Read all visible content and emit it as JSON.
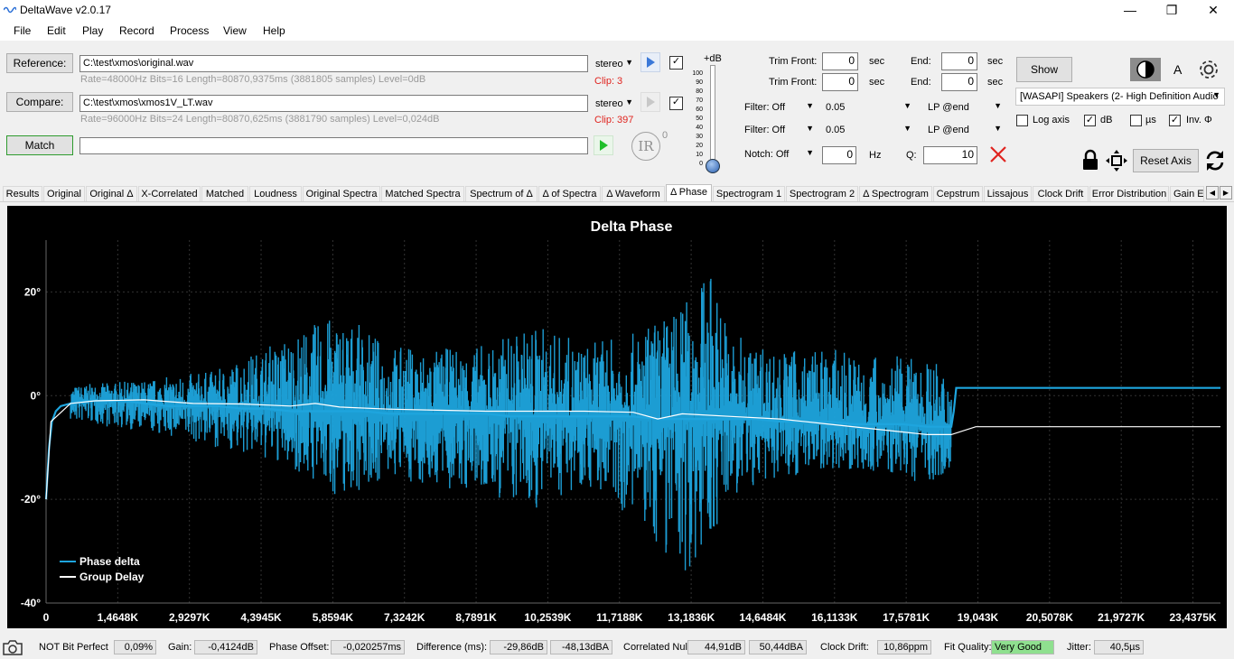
{
  "window": {
    "title": "DeltaWave v2.0.17",
    "minimize": "—",
    "restore": "❐",
    "close": "✕"
  },
  "menu": [
    "File",
    "Edit",
    "Play",
    "Record",
    "Process",
    "View",
    "Help"
  ],
  "reference": {
    "button": "Reference:",
    "path": "C:\\test\\xmos\\original.wav",
    "info": "Rate=48000Hz Bits=16 Length=80870,9375ms (3881805 samples) Level=0dB",
    "channel": "stereo",
    "clip": "Clip: 3"
  },
  "compare": {
    "button": "Compare:",
    "path": "C:\\test\\xmos\\xmos1V_LT.wav",
    "info": "Rate=96000Hz Bits=24 Length=80870,625ms (3881790 samples) Level=0,024dB",
    "channel": "stereo",
    "clip": "Clip: 397"
  },
  "match": {
    "button": "Match",
    "ir_label": "IR",
    "ir_sup": "0"
  },
  "level_slider": {
    "title": "+dB",
    "ticks": [
      "100",
      "90",
      "80",
      "70",
      "60",
      "50",
      "40",
      "30",
      "20",
      "10",
      "0"
    ],
    "value": 0
  },
  "trim": {
    "front_label": "Trim Front:",
    "front1": "0",
    "front2": "0",
    "end_label": "End:",
    "end1": "0",
    "end2": "0",
    "unit": "sec"
  },
  "filters": {
    "filter1": "Filter: Off",
    "filter1_value": "0.05",
    "filter1_mode": "LP @end",
    "filter2": "Filter: Off",
    "filter2_value": "0.05",
    "filter2_mode": "LP @end",
    "notch": "Notch: Off",
    "notch_value": "0",
    "notch_unit": "Hz",
    "q_label": "Q:",
    "q_value": "10"
  },
  "output": {
    "show_button": "Show",
    "font_label": "A",
    "device": "[WASAPI] Speakers (2- High Definition Audio",
    "log_axis": "Log axis",
    "db": "dB",
    "us": "µs",
    "inv": "Inv. Φ",
    "log_axis_checked": false,
    "db_checked": true,
    "us_checked": false,
    "inv_checked": true,
    "reset_axis": "Reset Axis"
  },
  "tabs": [
    "Results",
    "Original",
    "Original Δ",
    "X-Correlated",
    "Matched",
    "Loudness",
    "Original Spectra",
    "Matched Spectra",
    "Spectrum of Δ",
    "Δ of Spectra",
    "Δ Waveform",
    "Δ Phase",
    "Spectrogram 1",
    "Spectrogram 2",
    "Δ Spectrogram",
    "Cepstrum",
    "Lissajous",
    "Clock Drift",
    "Error Distribution",
    "Gain E"
  ],
  "active_tab": "Δ Phase",
  "chart_data": {
    "type": "line",
    "title": "Delta Phase",
    "xlabel": "",
    "ylabel": "",
    "xlim": [
      0,
      24000
    ],
    "ylim": [
      -40,
      30
    ],
    "x_ticks": [
      "0",
      "1,4648K",
      "2,9297K",
      "4,3945K",
      "5,8594K",
      "7,3242K",
      "8,7891K",
      "10,2539K",
      "11,7188K",
      "13,1836K",
      "14,6484K",
      "16,1133K",
      "17,5781K",
      "19,043K",
      "20,5078K",
      "21,9727K",
      "23,4375K"
    ],
    "y_ticks": [
      "20°",
      "0°",
      "-20°",
      "-40°"
    ],
    "grid": true,
    "legend_placement": "bottom-left",
    "series": [
      {
        "name": "Phase delta",
        "color": "#1ea5de",
        "x": [
          0,
          60,
          120,
          200,
          300,
          500,
          800,
          1200,
          1600,
          2000,
          2500,
          3000,
          3500,
          4000,
          4500,
          5000,
          5500,
          6000,
          6500,
          7000,
          7500,
          8000,
          8500,
          9000,
          9500,
          10000,
          10500,
          11000,
          11500,
          12000,
          12500,
          13000,
          13500,
          14000,
          14500,
          15000,
          15500,
          16000,
          16500,
          17000,
          17500,
          18000,
          18500,
          18550,
          18600,
          19000,
          20000,
          21000,
          22000,
          23000,
          24000
        ],
        "y": [
          -20,
          -10,
          -5,
          -3,
          -2,
          -1.5,
          -1,
          -1,
          -1,
          -1.5,
          -2,
          -2,
          -2,
          -2.5,
          -2.5,
          -3,
          -3,
          -3,
          -3,
          -3.5,
          -3.5,
          -3.5,
          -3.5,
          -3.5,
          -4,
          -4,
          -4,
          -4,
          -4,
          -4,
          -4.5,
          -4.5,
          -4.5,
          -4.5,
          -4.5,
          -5,
          -5,
          -5,
          -5.5,
          -5.5,
          -5.5,
          -6,
          -6,
          -3,
          1.5,
          1.5,
          1.5,
          1.5,
          1.5,
          1.5,
          1.5
        ],
        "envelope": {
          "x": [
            500,
            2000,
            3500,
            5000,
            6000,
            7000,
            8000,
            9000,
            10000,
            11000,
            12000,
            13000,
            13600,
            14000,
            15000,
            16000,
            17000,
            18000,
            18500
          ],
          "upper": [
            2,
            3,
            5,
            12,
            16,
            10,
            9,
            10,
            14,
            10,
            12,
            18,
            25,
            12,
            9,
            9,
            8,
            7,
            5
          ],
          "lower": [
            -5,
            -7,
            -10,
            -14,
            -20,
            -16,
            -18,
            -20,
            -22,
            -17,
            -24,
            -35,
            -28,
            -20,
            -16,
            -14,
            -15,
            -17,
            -14
          ]
        }
      },
      {
        "name": "Group Delay",
        "color": "#ffffff",
        "x": [
          0,
          100,
          500,
          1000,
          2000,
          3000,
          4000,
          5000,
          5500,
          6000,
          7000,
          8000,
          9000,
          10000,
          11000,
          12000,
          12500,
          13000,
          14000,
          15000,
          16000,
          17000,
          17500,
          18000,
          18500,
          19000,
          20000,
          21000,
          22000,
          23000,
          24000
        ],
        "y": [
          -20,
          -5,
          -1.5,
          -1,
          -0.8,
          -1.5,
          -1.6,
          -2,
          -1.5,
          -2.2,
          -2.6,
          -2.8,
          -3,
          -3,
          -3,
          -3.2,
          -4.5,
          -3.5,
          -4,
          -4.5,
          -5.5,
          -6.5,
          -7,
          -7.5,
          -7.5,
          -6,
          -6,
          -6,
          -6,
          -6,
          -6
        ]
      }
    ]
  },
  "status": {
    "bit_perfect_label": "NOT Bit Perfect",
    "bit_perfect_value": "0,09%",
    "gain_label": "Gain:",
    "gain_value": "-0,4124dB",
    "phase_offset_label": "Phase Offset:",
    "phase_offset_value": "-0,020257ms",
    "difference_label": "Difference (ms):",
    "difference_db": "-29,86dB",
    "difference_dba": "-48,13dBA",
    "correlated_null_label": "Correlated Null:",
    "correlated_null_db": "44,91dB",
    "correlated_null_dba": "50,44dBA",
    "clock_drift_label": "Clock Drift:",
    "clock_drift_value": "10,86ppm",
    "fit_quality_label": "Fit Quality:",
    "fit_quality_value": "Very Good",
    "jitter_label": "Jitter:",
    "jitter_value": "40,5µs"
  }
}
